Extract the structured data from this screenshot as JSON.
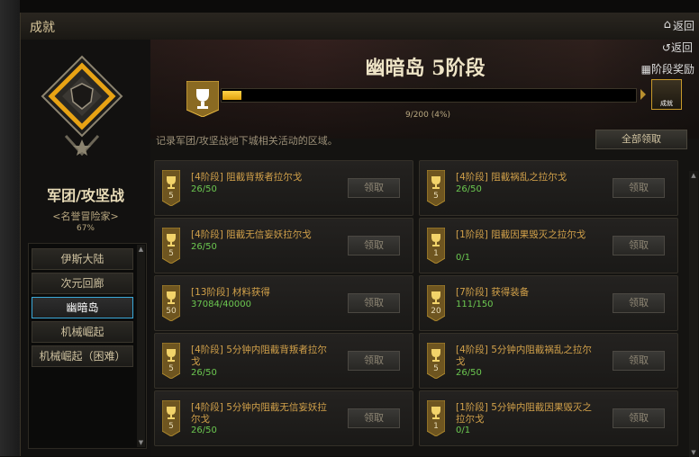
{
  "window": {
    "title": "成就",
    "back_label": "返回",
    "home_icon": "home-icon"
  },
  "left": {
    "guild_name": "军团/攻坚战",
    "guild_title": "<名誉冒险家>",
    "guild_percent": "67%",
    "menu": [
      {
        "label": "伊斯大陆",
        "active": false
      },
      {
        "label": "次元回廊",
        "active": false
      },
      {
        "label": "幽暗岛",
        "active": true
      },
      {
        "label": "机械崛起",
        "active": false
      },
      {
        "label": "机械崛起（困难）",
        "active": false
      }
    ]
  },
  "main": {
    "stage_title": "幽暗岛 5阶段",
    "back_label": "返回",
    "reward_label": "阶段奖励",
    "progress": {
      "current": 9,
      "total": 200,
      "fraction": 0.045,
      "text": "9/200 (4%)"
    },
    "chest_label": "成就",
    "description": "记录军团/攻坚战地下城相关活动的区域。",
    "claim_all_label": "全部领取",
    "cards": [
      {
        "title": "[4阶段] 阻截背叛者拉尔戈",
        "progress": "26/50",
        "level": "5",
        "button": "领取"
      },
      {
        "title": "[4阶段] 阻截祸乱之拉尔戈",
        "progress": "26/50",
        "level": "5",
        "button": "领取"
      },
      {
        "title": "[4阶段] 阻截无信妄妖拉尔戈",
        "progress": "26/50",
        "level": "5",
        "button": "领取"
      },
      {
        "title": "[1阶段] 阻截因果毁灭之拉尔戈",
        "progress": "0/1",
        "level": "1",
        "button": "领取"
      },
      {
        "title": "[13阶段] 材料获得",
        "progress": "37084/40000",
        "level": "50",
        "button": "领取"
      },
      {
        "title": "[7阶段] 获得装备",
        "progress": "111/150",
        "level": "20",
        "button": "领取"
      },
      {
        "title": "[4阶段] 5分钟内阻截背叛者拉尔戈",
        "progress": "26/50",
        "level": "5",
        "button": "领取"
      },
      {
        "title": "[4阶段] 5分钟内阻截祸乱之拉尔戈",
        "progress": "26/50",
        "level": "5",
        "button": "领取"
      },
      {
        "title": "[4阶段] 5分钟内阻截无信妄妖拉尔戈",
        "progress": "26/50",
        "level": "5",
        "button": "领取"
      },
      {
        "title": "[1阶段] 5分钟内阻截因果毁灭之拉尔戈",
        "progress": "0/1",
        "level": "1",
        "button": "领取"
      }
    ]
  },
  "colors": {
    "accent_gold": "#e8a314",
    "progress_green": "#6cc850",
    "title_orange": "#d2a14a",
    "active_border": "#3aa8d8"
  }
}
